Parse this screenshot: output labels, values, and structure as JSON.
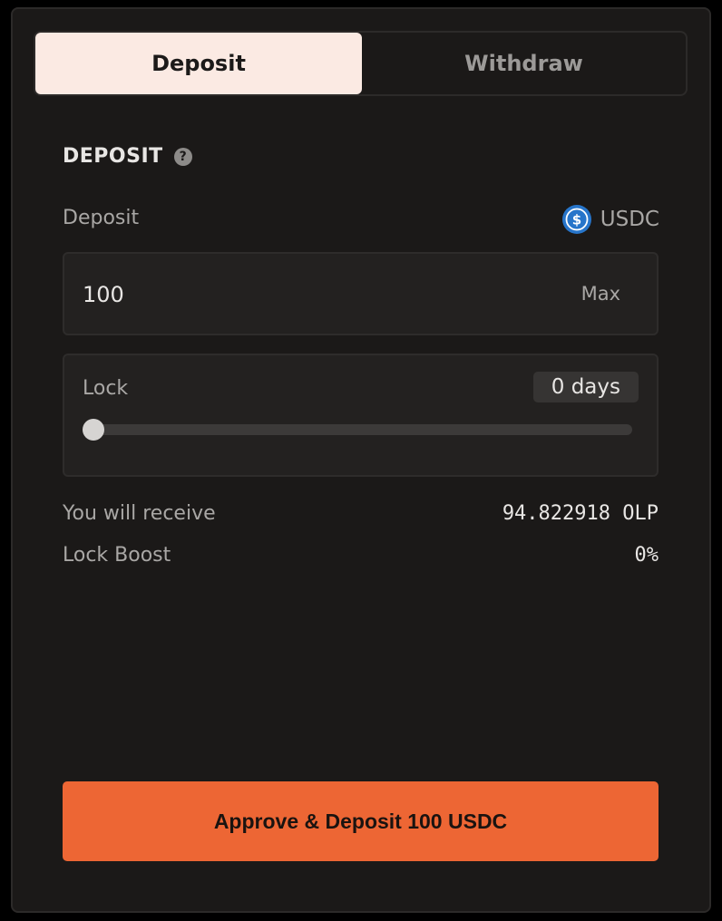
{
  "tabs": [
    {
      "label": "Deposit",
      "active": true
    },
    {
      "label": "Withdraw",
      "active": false
    }
  ],
  "section": {
    "title": "DEPOSIT",
    "help_icon": "question-circle-icon",
    "help_glyph": "?"
  },
  "deposit": {
    "label": "Deposit",
    "token_icon": "usdc-coin-icon",
    "token_symbol": "USDC",
    "amount_value": "100",
    "max_label": "Max"
  },
  "lock": {
    "label": "Lock",
    "days_display": "0 days",
    "slider_value_fraction": 0
  },
  "summary": {
    "receive_label": "You will receive",
    "receive_value": "94.822918 OLP",
    "boost_label": "Lock Boost",
    "boost_value": "0%"
  },
  "cta": {
    "label": "Approve & Deposit 100 USDC"
  },
  "colors": {
    "accent": "#ed6634",
    "active_tab_bg": "#fbeae3",
    "panel_bg": "#1b1918",
    "usdc_blue": "#2775ca"
  }
}
